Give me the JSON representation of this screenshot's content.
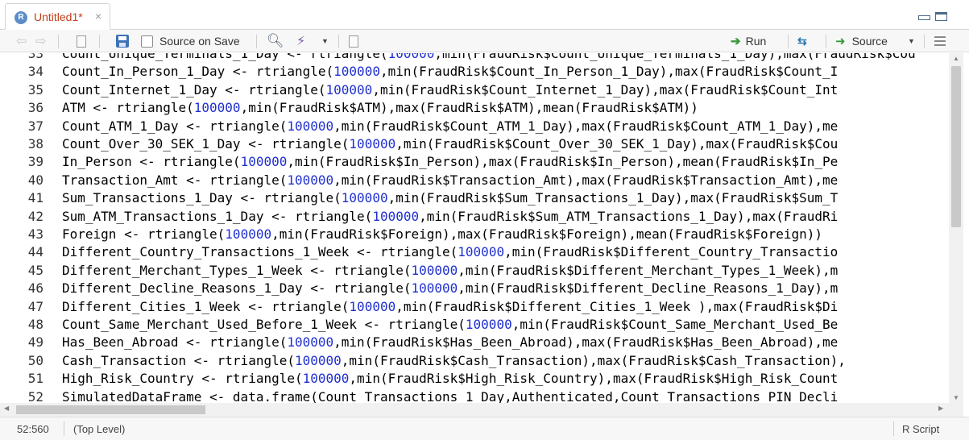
{
  "tab": {
    "title": "Untitled1*",
    "close": "×",
    "icon": "r-file-icon"
  },
  "toolbar": {
    "source_on_save": "Source on Save",
    "run": "Run",
    "source": "Source"
  },
  "editor": {
    "lines": [
      {
        "n": "33",
        "segs": [
          [
            "Count_Unique_Terminals_1_Day <- rtriangle(",
            ""
          ],
          [
            "100000",
            "num"
          ],
          [
            ",min(FraudRisk$Count_Unique_Terminals_1_Day),max(FraudRisk$Cou",
            ""
          ]
        ]
      },
      {
        "n": "34",
        "segs": [
          [
            "Count_In_Person_1_Day <- rtriangle(",
            ""
          ],
          [
            "100000",
            "num"
          ],
          [
            ",min(FraudRisk$Count_In_Person_1_Day),max(FraudRisk$Count_I",
            ""
          ]
        ]
      },
      {
        "n": "35",
        "segs": [
          [
            "Count_Internet_1_Day <- rtriangle(",
            ""
          ],
          [
            "100000",
            "num"
          ],
          [
            ",min(FraudRisk$Count_Internet_1_Day),max(FraudRisk$Count_Int",
            ""
          ]
        ]
      },
      {
        "n": "36",
        "segs": [
          [
            "ATM <- rtriangle(",
            ""
          ],
          [
            "100000",
            "num"
          ],
          [
            ",min(FraudRisk$ATM),max(FraudRisk$ATM),mean(FraudRisk$ATM))",
            ""
          ]
        ]
      },
      {
        "n": "37",
        "segs": [
          [
            "Count_ATM_1_Day <- rtriangle(",
            ""
          ],
          [
            "100000",
            "num"
          ],
          [
            ",min(FraudRisk$Count_ATM_1_Day),max(FraudRisk$Count_ATM_1_Day),me",
            ""
          ]
        ]
      },
      {
        "n": "38",
        "segs": [
          [
            "Count_Over_30_SEK_1_Day <- rtriangle(",
            ""
          ],
          [
            "100000",
            "num"
          ],
          [
            ",min(FraudRisk$Count_Over_30_SEK_1_Day),max(FraudRisk$Cou",
            ""
          ]
        ]
      },
      {
        "n": "39",
        "segs": [
          [
            "In_Person <- rtriangle(",
            ""
          ],
          [
            "100000",
            "num"
          ],
          [
            ",min(FraudRisk$In_Person),max(FraudRisk$In_Person),mean(FraudRisk$In_Pe",
            ""
          ]
        ]
      },
      {
        "n": "40",
        "segs": [
          [
            "Transaction_Amt <- rtriangle(",
            ""
          ],
          [
            "100000",
            "num"
          ],
          [
            ",min(FraudRisk$Transaction_Amt),max(FraudRisk$Transaction_Amt),me",
            ""
          ]
        ]
      },
      {
        "n": "41",
        "segs": [
          [
            "Sum_Transactions_1_Day <- rtriangle(",
            ""
          ],
          [
            "100000",
            "num"
          ],
          [
            ",min(FraudRisk$Sum_Transactions_1_Day),max(FraudRisk$Sum_T",
            ""
          ]
        ]
      },
      {
        "n": "42",
        "segs": [
          [
            "Sum_ATM_Transactions_1_Day <- rtriangle(",
            ""
          ],
          [
            "100000",
            "num"
          ],
          [
            ",min(FraudRisk$Sum_ATM_Transactions_1_Day),max(FraudRi",
            ""
          ]
        ]
      },
      {
        "n": "43",
        "segs": [
          [
            "Foreign <- rtriangle(",
            ""
          ],
          [
            "100000",
            "num"
          ],
          [
            ",min(FraudRisk$Foreign),max(FraudRisk$Foreign),mean(FraudRisk$Foreign))",
            ""
          ]
        ]
      },
      {
        "n": "44",
        "segs": [
          [
            "Different_Country_Transactions_1_Week <- rtriangle(",
            ""
          ],
          [
            "100000",
            "num"
          ],
          [
            ",min(FraudRisk$Different_Country_Transactio",
            ""
          ]
        ]
      },
      {
        "n": "45",
        "segs": [
          [
            "Different_Merchant_Types_1_Week <- rtriangle(",
            ""
          ],
          [
            "100000",
            "num"
          ],
          [
            ",min(FraudRisk$Different_Merchant_Types_1_Week),m",
            ""
          ]
        ]
      },
      {
        "n": "46",
        "segs": [
          [
            "Different_Decline_Reasons_1_Day <- rtriangle(",
            ""
          ],
          [
            "100000",
            "num"
          ],
          [
            ",min(FraudRisk$Different_Decline_Reasons_1_Day),m",
            ""
          ]
        ]
      },
      {
        "n": "47",
        "segs": [
          [
            "Different_Cities_1_Week <- rtriangle(",
            ""
          ],
          [
            "100000",
            "num"
          ],
          [
            ",min(FraudRisk$Different_Cities_1_Week ),max(FraudRisk$Di",
            ""
          ]
        ]
      },
      {
        "n": "48",
        "segs": [
          [
            "Count_Same_Merchant_Used_Before_1_Week <- rtriangle(",
            ""
          ],
          [
            "100000",
            "num"
          ],
          [
            ",min(FraudRisk$Count_Same_Merchant_Used_Be",
            ""
          ]
        ]
      },
      {
        "n": "49",
        "segs": [
          [
            "Has_Been_Abroad <- rtriangle(",
            ""
          ],
          [
            "100000",
            "num"
          ],
          [
            ",min(FraudRisk$Has_Been_Abroad),max(FraudRisk$Has_Been_Abroad),me",
            ""
          ]
        ]
      },
      {
        "n": "50",
        "segs": [
          [
            "Cash_Transaction <- rtriangle(",
            ""
          ],
          [
            "100000",
            "num"
          ],
          [
            ",min(FraudRisk$Cash_Transaction),max(FraudRisk$Cash_Transaction),",
            ""
          ]
        ]
      },
      {
        "n": "51",
        "segs": [
          [
            "High_Risk_Country <- rtriangle(",
            ""
          ],
          [
            "100000",
            "num"
          ],
          [
            ",min(FraudRisk$High_Risk_Country),max(FraudRisk$High_Risk_Count",
            ""
          ]
        ]
      },
      {
        "n": "52",
        "segs": [
          [
            "SimulatedDataFrame <- data.frame(Count_Transactions_1_Day,Authenticated,Count_Transactions_PIN_Decli",
            ""
          ]
        ]
      }
    ]
  },
  "status": {
    "position": "52:560",
    "scope": "(Top Level)",
    "file_type": "R Script"
  },
  "colors": {
    "tab_title": "#c3401a",
    "number": "#1f2fcf",
    "run_green": "#3a9a3a"
  }
}
